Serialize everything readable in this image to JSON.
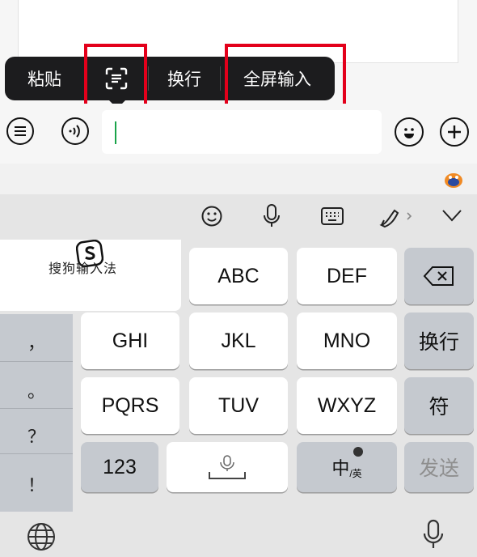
{
  "context_menu": {
    "paste": "粘贴",
    "scan_icon": "scan-text-icon",
    "newline": "换行",
    "fullscreen": "全屏输入"
  },
  "input_bar": {
    "list_icon": "list-icon",
    "voice_icon": "voice-icon",
    "emoji_icon": "emoji-icon",
    "add_icon": "plus-icon"
  },
  "keyboard": {
    "brand": "搜狗输入法",
    "toolbar_icons": [
      "emoji-icon",
      "microphone-icon",
      "keyboard-icon",
      "handwriting-icon",
      "collapse-icon"
    ],
    "rows": [
      [
        "ABC",
        "DEF"
      ],
      [
        "GHI",
        "JKL",
        "MNO"
      ],
      [
        "PQRS",
        "TUV",
        "WXYZ"
      ]
    ],
    "newline_key": "换行",
    "symbol_key": "符",
    "num_key": "123",
    "lang_key_main": "中",
    "lang_key_sub": "/英",
    "send_key": "发送",
    "punctuation": [
      "，",
      "。",
      "？",
      "！"
    ]
  },
  "colors": {
    "highlight_box": "#e3001b",
    "cursor": "#1aa34a",
    "menu_bg": "#1c1c1e"
  }
}
